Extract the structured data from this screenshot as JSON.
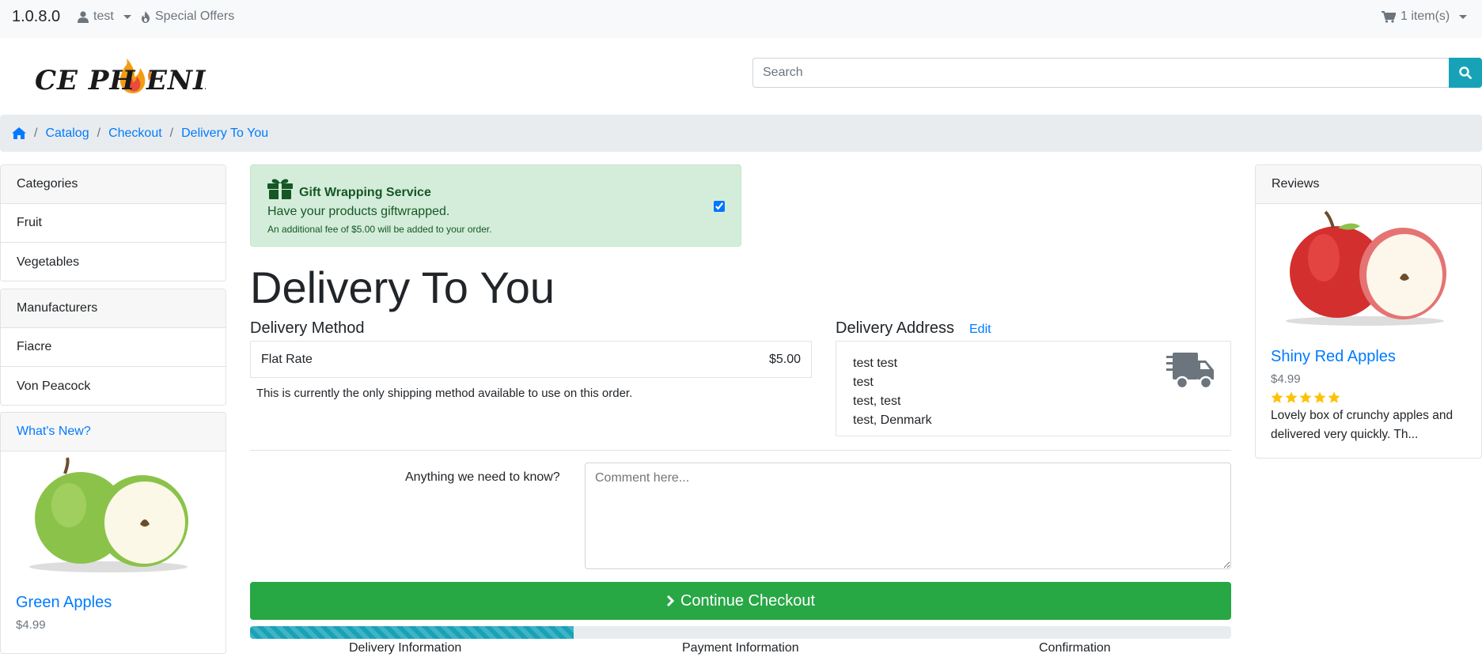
{
  "topbar": {
    "version": "1.0.8.0",
    "account_label": "test",
    "offers_label": "Special Offers",
    "cart_label": "1 item(s)"
  },
  "header": {
    "logo_alt": "CE PHOENIX",
    "search_placeholder": "Search"
  },
  "breadcrumb": {
    "items": [
      "Catalog",
      "Checkout",
      "Delivery To You"
    ]
  },
  "left_sidebar": {
    "categories_title": "Categories",
    "categories": [
      "Fruit",
      "Vegetables"
    ],
    "manufacturers_title": "Manufacturers",
    "manufacturers": [
      "Fiacre",
      "Von Peacock"
    ],
    "whats_new_title": "What's New?",
    "product": {
      "name": "Green Apples",
      "price": "$4.99"
    }
  },
  "gift": {
    "title": "Gift Wrapping Service",
    "line1": "Have your products giftwrapped.",
    "line2": "An additional fee of $5.00 will be added to your order.",
    "checked": true
  },
  "main": {
    "page_title": "Delivery To You",
    "delivery_method_title": "Delivery Method",
    "method_name": "Flat Rate",
    "method_price": "$5.00",
    "method_note": "This is currently the only shipping method available to use on this order.",
    "delivery_address_title": "Delivery Address",
    "edit_label": "Edit",
    "address_lines": [
      "test test",
      "test",
      "test, test",
      "test, Denmark"
    ],
    "comment_label": "Anything we need to know?",
    "comment_placeholder": "Comment here...",
    "continue_label": "Continue Checkout",
    "progress_fraction": 0.33,
    "steps": [
      "Delivery Information",
      "Payment Information",
      "Confirmation"
    ]
  },
  "right_sidebar": {
    "reviews_title": "Reviews",
    "product": {
      "name": "Shiny Red Apples",
      "price": "$4.99",
      "rating": 5,
      "review": "Lovely box of crunchy apples and delivered very quickly. Th..."
    }
  },
  "colors": {
    "primary": "#007bff",
    "success": "#28a745",
    "info": "#17a2b8",
    "gift_bg": "#d4edda",
    "star": "#ffc107"
  }
}
